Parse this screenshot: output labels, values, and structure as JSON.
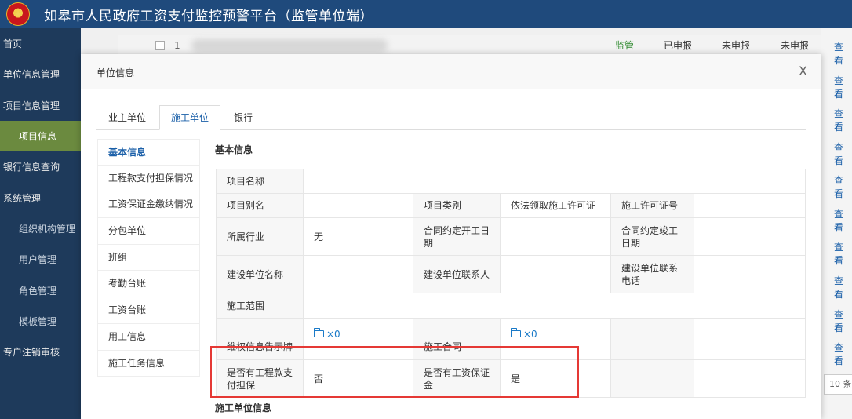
{
  "header": {
    "title": "如皋市人民政府工资支付监控预警平台（监管单位端）",
    "emblem_icon": "national-emblem-icon"
  },
  "sidebar": {
    "items": [
      {
        "label": "首页",
        "sub": false,
        "active": false
      },
      {
        "label": "单位信息管理",
        "sub": false,
        "active": false
      },
      {
        "label": "项目信息管理",
        "sub": false,
        "active": false
      },
      {
        "label": "项目信息",
        "sub": true,
        "active": true
      },
      {
        "label": "银行信息查询",
        "sub": false,
        "active": false
      },
      {
        "label": "系统管理",
        "sub": false,
        "active": false
      },
      {
        "label": "组织机构管理",
        "sub": true,
        "active": false
      },
      {
        "label": "用户管理",
        "sub": true,
        "active": false
      },
      {
        "label": "角色管理",
        "sub": true,
        "active": false
      },
      {
        "label": "模板管理",
        "sub": true,
        "active": false
      },
      {
        "label": "专户注销审核",
        "sub": false,
        "active": false
      }
    ]
  },
  "background_table": {
    "row_index": "1",
    "status_1": "监管",
    "status_2": "已申报",
    "status_3": "未申报",
    "status_4": "未申报",
    "view_label": "查看",
    "page_size": "10 条"
  },
  "modal": {
    "title": "单位信息",
    "close": "X",
    "tabs": [
      {
        "label": "业主单位",
        "active": false
      },
      {
        "label": "施工单位",
        "active": true
      },
      {
        "label": "银行",
        "active": false
      }
    ],
    "side_menu": [
      {
        "label": "基本信息",
        "active": true
      },
      {
        "label": "工程款支付担保情况",
        "active": false
      },
      {
        "label": "工资保证金缴纳情况",
        "active": false
      },
      {
        "label": "分包单位",
        "active": false
      },
      {
        "label": "班组",
        "active": false
      },
      {
        "label": "考勤台账",
        "active": false
      },
      {
        "label": "工资台账",
        "active": false
      },
      {
        "label": "用工信息",
        "active": false
      },
      {
        "label": "施工任务信息",
        "active": false
      }
    ],
    "section_basic": "基本信息",
    "section_unit": "施工单位信息",
    "table": {
      "project_name_label": "项目名称",
      "project_name": "",
      "alias_label": "项目别名",
      "alias": "",
      "category_label": "项目类别",
      "category": "依法领取施工许可证",
      "permit_label": "施工许可证号",
      "permit": "",
      "industry_label": "所属行业",
      "industry": "无",
      "start_label": "合同约定开工日期",
      "start": "",
      "end_label": "合同约定竣工日期",
      "end": "",
      "builder_label": "建设单位名称",
      "builder": "",
      "contact_label": "建设单位联系人",
      "contact": "",
      "phone_label": "建设单位联系电话",
      "phone": "",
      "scope_label": "施工范围",
      "scope": "",
      "rights_label": "维权信息告示牌",
      "rights_files": "×0",
      "contract_label": "施工合同",
      "contract_files": "×0",
      "guarantee_label": "是否有工程款支付担保",
      "guarantee": "否",
      "deposit_label": "是否有工资保证金",
      "deposit": "是"
    }
  }
}
